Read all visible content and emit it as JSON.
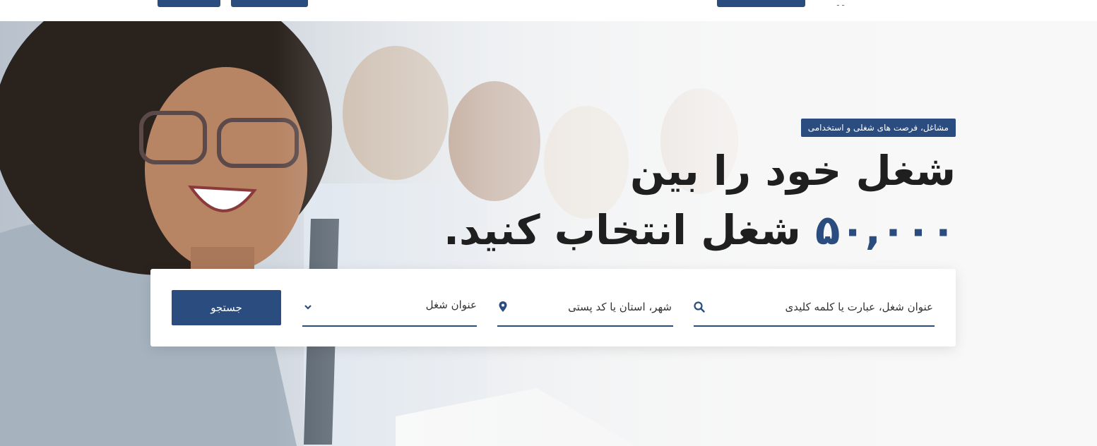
{
  "colors": {
    "brand": "#2b4c7e",
    "headline": "#1f1f1f",
    "card_bg": "#ffffff"
  },
  "hero": {
    "badge": "مشاغل، فرصت های شغلی و استخدامی",
    "headline_line1": "شغل خود را بین",
    "headline_number": "۵۰,۰۰۰",
    "headline_line2_rest": "شغل انتخاب کنید."
  },
  "search": {
    "keyword_placeholder": "عنوان شغل، عبارت یا کلمه کلیدی",
    "location_placeholder": "شهر، استان یا کد پستی",
    "category_label": "عنوان شغل",
    "submit_label": "جستجو",
    "icons": {
      "keyword": "search-icon",
      "location": "map-pin-icon",
      "category": "chevron-down-icon"
    }
  }
}
